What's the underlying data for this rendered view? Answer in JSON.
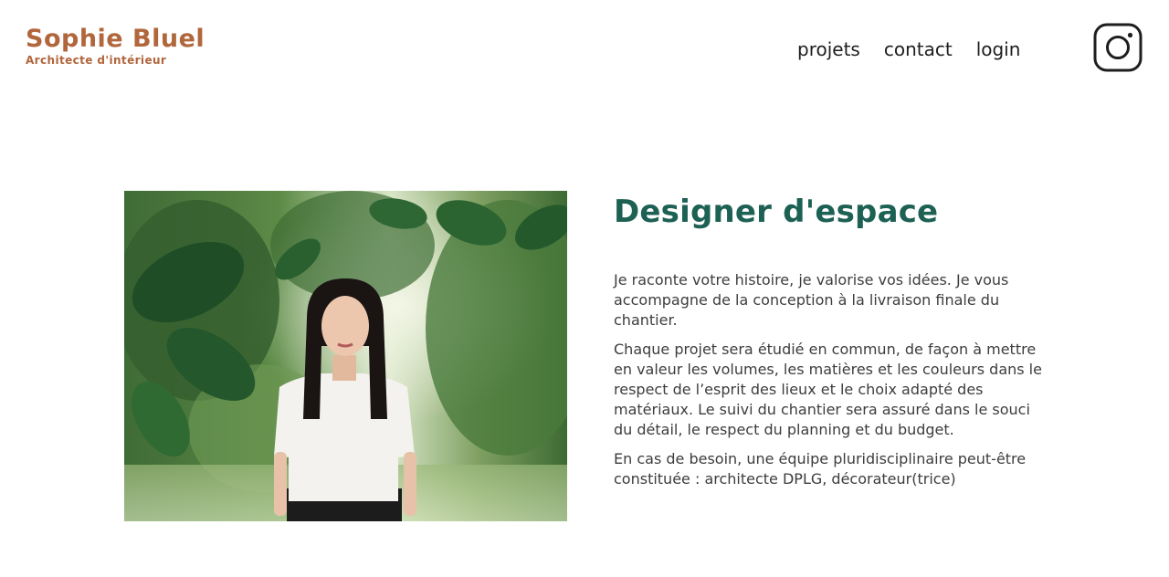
{
  "header": {
    "logo_title": "Sophie Bluel",
    "logo_subtitle": "Architecte d'intérieur",
    "nav": {
      "projets": "projets",
      "contact": "contact",
      "login": "login"
    },
    "social_icon": "instagram-icon"
  },
  "intro": {
    "photo_icon": "portrait-photo",
    "heading": "Designer d'espace",
    "paragraphs": [
      "Je raconte votre histoire, je valorise vos idées. Je vous accompagne de la conception à la livraison finale du chantier.",
      "Chaque projet sera étudié en commun, de façon à mettre en valeur les volumes, les matières et les couleurs dans le respect de l’esprit des lieux et le choix adapté des matériaux. Le suivi du chantier sera assuré dans le souci du détail, le respect du planning et du budget.",
      "En cas de besoin, une équipe pluridisciplinaire peut-être constituée : architecte DPLG, décorateur(trice)"
    ]
  },
  "colors": {
    "brand": "#b1663c",
    "heading": "#1d6154",
    "text": "#3d3d3d",
    "background": "#ffffff"
  }
}
